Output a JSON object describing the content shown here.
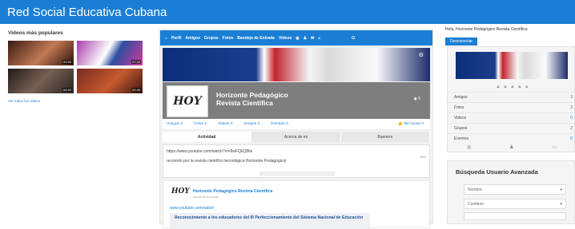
{
  "header": {
    "site_title": "Red Social Educativa Cubana"
  },
  "left": {
    "section_title": "Videos más populares",
    "videos": [
      {
        "duration": "00:55"
      },
      {
        "duration": "07:44"
      },
      {
        "duration": "00:53"
      },
      {
        "duration": "00:48"
      }
    ],
    "see_all": "Ver todos los videos"
  },
  "nav": {
    "items": [
      "Perfil",
      "Amigos",
      "Grupos",
      "Fotos",
      "Bandeja de Entrada",
      "Videos"
    ]
  },
  "profile": {
    "name_line1": "Horizonte Pedagógico",
    "name_line2": "Revista Científica",
    "count": "0",
    "avatar_text": "HOY"
  },
  "subtabs": {
    "items": [
      "Amigos 3",
      "Fotos 2",
      "Videos 0",
      "Grupos 2",
      "Eventos 0"
    ],
    "likes": "Me Gusta 0"
  },
  "tabs": [
    "Actividad",
    "Acerca de mi",
    "Banners"
  ],
  "composer": {
    "url": "https://www.youtube.com/watch?v=I6wFQkQ8kk",
    "text": "recorrido por la revista científico tecnológica Horizonte Pedagógico|",
    "small": "3600"
  },
  "post": {
    "avatar_text": "HOY",
    "author": "Horizonte Pedagógico Revista Científica",
    "time": "menos de un minuto",
    "link": "www.youtube.com/watch",
    "preview_title": "Reconocimiento a los educadores del III Perfeccionamiento del Sistema Nacional de Educación"
  },
  "right": {
    "hello": "Hola, Horizonte Pedagógico Revista Científica",
    "logout": "Desconectar",
    "stats": [
      {
        "label": "Amigos",
        "value": "3"
      },
      {
        "label": "Fotos",
        "value": "2"
      },
      {
        "label": "Videos",
        "value": "0"
      },
      {
        "label": "Grupos",
        "value": "2"
      },
      {
        "label": "Eventos",
        "value": "0"
      }
    ],
    "search_title": "Búsqueda Usuario Avanzada",
    "search_fields": [
      "Nombre",
      "Contiene"
    ]
  },
  "colors": {
    "accent": "#1a7fd4",
    "profile_bar": "#7e7e7e"
  }
}
